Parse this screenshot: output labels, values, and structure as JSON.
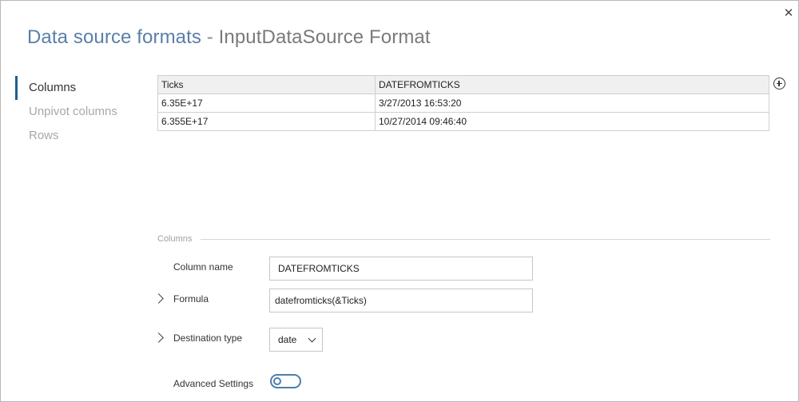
{
  "dialog": {
    "title_main": "Data source formats",
    "title_separator": "-",
    "title_sub": "InputDataSource Format",
    "close_icon": "close-icon"
  },
  "nav": {
    "items": [
      {
        "label": "Columns",
        "active": true
      },
      {
        "label": "Unpivot columns",
        "active": false
      },
      {
        "label": "Rows",
        "active": false
      }
    ]
  },
  "grid": {
    "columns": [
      "Ticks",
      "DATEFROMTICKS"
    ],
    "rows": [
      [
        "6.35E+17",
        "3/27/2013 16:53:20"
      ],
      [
        "6.355E+17",
        "10/27/2014 09:46:40"
      ]
    ],
    "add_column_icon": "plus-circle-icon"
  },
  "columns_section": {
    "heading": "Columns",
    "column_name_label": "Column name",
    "column_name_value": "DATEFROMTICKS",
    "formula_label": "Formula",
    "formula_value": "datefromticks(&Ticks)",
    "destination_type_label": "Destination type",
    "destination_type_value": "date",
    "advanced_settings_label": "Advanced Settings",
    "advanced_settings_on": false
  },
  "colors": {
    "title": "#5a7fa8",
    "accent": "#1f5f8f",
    "toggle": "#4c7fae"
  }
}
